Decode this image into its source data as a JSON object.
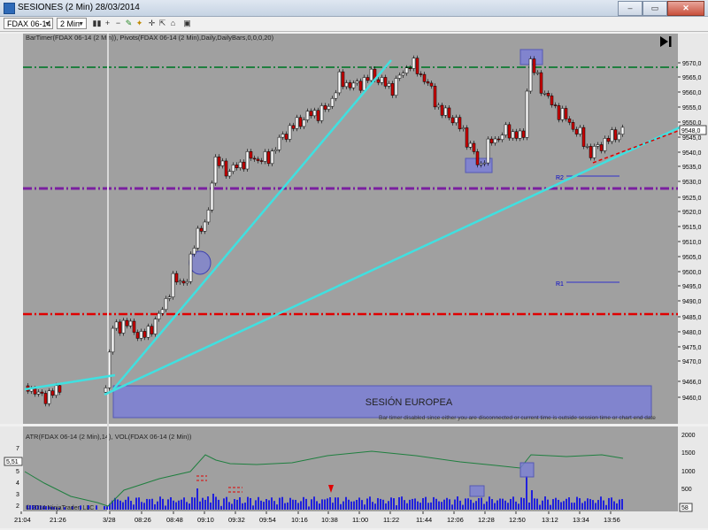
{
  "window": {
    "title": "SESIONES (2 Min)  28/03/2014",
    "minimize_label": "–",
    "maximize_label": "▭",
    "close_label": "✕",
    "small_button_label": "L"
  },
  "toolbar": {
    "instrument": "FDAX 06-14",
    "interval": "2 Min"
  },
  "chart": {
    "indicators_label": "BarTimer(FDAX 06-14 (2 Min)), Pivots(FDAX 06-14 (2 Min),Daily,DailyBars,0,0,0,20)",
    "session_box_label": "SESIÓN EUROPEA",
    "bar_timer_message": "Bar timer disabled since either you are disconnected or current time is outside session time or chart end date",
    "pivot_labels": [
      "R2",
      "R1"
    ],
    "current_price_label": "9548,0",
    "play_icon": "skip-to-end-icon",
    "price_ticks": [
      "9570,0",
      "9565,0",
      "9560,0",
      "9555,0",
      "9550,0",
      "9545,0",
      "9540,0",
      "9535,0",
      "9530,0",
      "9525,0",
      "9520,0",
      "9515,0",
      "9510,0",
      "9505,0",
      "9500,0",
      "9495,0",
      "9490,0",
      "9485,0",
      "9480,0",
      "9475,0",
      "9470,0",
      "9466,0",
      "9460,0"
    ],
    "colors": {
      "background": "#a0a0a0",
      "up_candle": "#ffffff",
      "down_candle": "#cc0000",
      "green_line": "#1f7f3f",
      "purple_line": "#7a1fa0",
      "red_line": "#e00000",
      "trendline": "#40e0e0",
      "session_box": "#7b7fd6"
    }
  },
  "lower_panel": {
    "indicators_label": "ATR(FDAX 06-14 (2 Min),14), VOL(FDAX 06-14 (2 Min))",
    "atr_value_label": "5,51",
    "left_ticks": [
      "7",
      "6",
      "5",
      "4",
      "3",
      "2"
    ],
    "right_ticks": [
      "2000",
      "1500",
      "1000",
      "500"
    ],
    "right_value_label": "58",
    "copyright": "© 2014 NinjaTrader, LLC"
  },
  "time_axis": [
    "21:04",
    "21:26",
    "3/28",
    "08:26",
    "08:48",
    "09:10",
    "09:32",
    "09:54",
    "10:16",
    "10:38",
    "11:00",
    "11:22",
    "11:44",
    "12:06",
    "12:28",
    "12:50",
    "13:12",
    "13:34",
    "13:56"
  ]
}
